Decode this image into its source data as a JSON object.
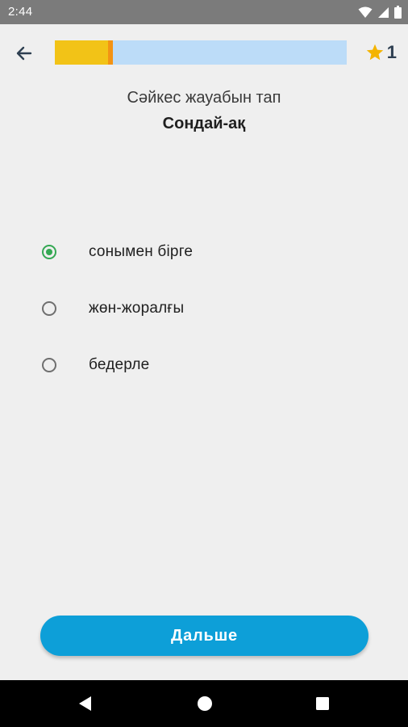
{
  "status_bar": {
    "time": "2:44",
    "icons": [
      "wifi-icon",
      "signal-icon",
      "battery-icon"
    ]
  },
  "top_bar": {
    "back_icon": "arrow-left-icon",
    "progress_fraction": 0.2,
    "score_icon": "star-icon",
    "score": "1",
    "colors": {
      "progress_track": "#bcdcf8",
      "progress_fill": "#f2c317",
      "progress_marker": "#f39314",
      "star": "#f4b400"
    }
  },
  "quiz": {
    "prompt": "Сәйкес жауабын тап",
    "word": "Сондай-ақ",
    "options": [
      {
        "label": "сонымен бірге",
        "selected": true
      },
      {
        "label": "жөн-жоралғы",
        "selected": false
      },
      {
        "label": "бедерле",
        "selected": false
      }
    ]
  },
  "footer": {
    "next_label": "Дальше",
    "accent": "#0d9fd8"
  },
  "nav_bar": {
    "icons": [
      "back-triangle-icon",
      "home-circle-icon",
      "recents-square-icon"
    ]
  }
}
